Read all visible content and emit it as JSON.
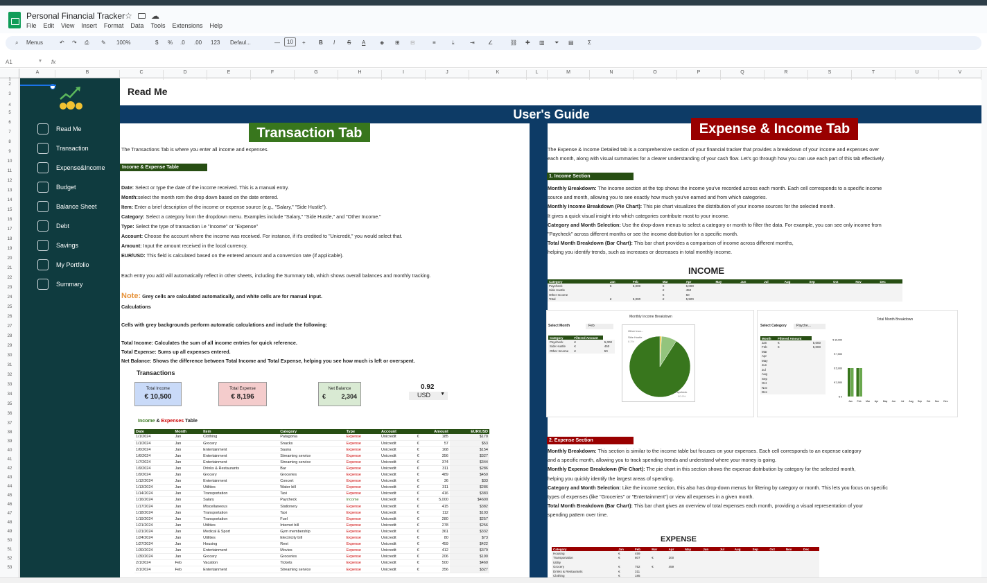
{
  "app": {
    "title": "Personal Financial Tracker",
    "menus": [
      "File",
      "Edit",
      "View",
      "Insert",
      "Format",
      "Data",
      "Tools",
      "Extensions",
      "Help"
    ],
    "toolbar": {
      "search_label": "Menus",
      "zoom": "100%",
      "currency": "$",
      "percent": "%",
      "dec_less": ".0",
      "dec_more": ".00",
      "number_format": "123",
      "font": "Defaul...",
      "font_size": "10",
      "minus": "—",
      "plus": "+",
      "bold": "B",
      "italic": "I",
      "strike": "S",
      "text_color": "A",
      "sigma": "Σ"
    },
    "name_box": "A1",
    "fx": "fx",
    "columns": [
      "A",
      "B",
      "C",
      "D",
      "E",
      "F",
      "G",
      "H",
      "I",
      "J",
      "K",
      "L",
      "M",
      "N",
      "O",
      "P",
      "Q",
      "R",
      "S",
      "T",
      "U",
      "V"
    ],
    "rows": [
      "1",
      "2",
      "3",
      "4",
      "5",
      "6",
      "7",
      "8",
      "9",
      "10",
      "11",
      "12",
      "13",
      "14",
      "15",
      "16",
      "17",
      "18",
      "19",
      "20",
      "21",
      "22",
      "23",
      "24",
      "25",
      "26",
      "27",
      "28",
      "29",
      "30",
      "31",
      "32",
      "33",
      "34",
      "35",
      "36",
      "37",
      "38",
      "39",
      "40",
      "41",
      "42",
      "43",
      "44",
      "45",
      "46",
      "47",
      "48",
      "49",
      "50",
      "51",
      "52",
      "53"
    ]
  },
  "sidebar": {
    "items": [
      {
        "label": "Read Me",
        "icon": "book-reader-icon"
      },
      {
        "label": "Transaction",
        "icon": "receipt-icon"
      },
      {
        "label": "Expense&Income",
        "icon": "coin-dollar-icon"
      },
      {
        "label": "Budget",
        "icon": "wallet-icon"
      },
      {
        "label": "Balance Sheet",
        "icon": "ledger-icon"
      },
      {
        "label": "Debt",
        "icon": "debt-card-icon"
      },
      {
        "label": "Savings",
        "icon": "piggy-bank-icon"
      },
      {
        "label": "My Portfolio",
        "icon": "portfolio-chart-icon"
      },
      {
        "label": "Summary",
        "icon": "summary-icon"
      }
    ]
  },
  "readme": {
    "title": "Read Me",
    "guide_title": "User's Guide",
    "transaction_tab": {
      "title": "Transaction Tab",
      "intro": "The Transactions Tab is where you enter all income and expenses.",
      "section_label": "Income & Expense Table",
      "fields": [
        {
          "k": "Date:",
          "v": " Select or type the date of the income received. This is a manual entry."
        },
        {
          "k": "Month:",
          "v": "select the month rom the drop down based on the date entered."
        },
        {
          "k": "Item:",
          "v": " Enter a brief description of the income or expense source (e.g., \"Salary,\" \"Side Hustle\")."
        },
        {
          "k": "Category:",
          "v": " Select a category from the dropdown menu. Examples include \"Salary,\" \"Side Hustle,\" and \"Other Income.\""
        },
        {
          "k": "Type:",
          "v": " Select the type of transaction i.e \"Income\" or \"Expense\""
        },
        {
          "k": "Account:",
          "v": " Choose the account where the income was received. For instance, if it's credited to \"Unicredit,\" you would select that."
        },
        {
          "k": "Amount:",
          "v": " Input the amount received in the local currency."
        },
        {
          "k": "EUR/USD:",
          "v": " This field is calculated based on the entered amount and a conversion rate (if applicable)."
        }
      ],
      "auto_reflect": "Each entry you add will automatically reflect in other sheets, including the Summary tab, which shows overall balances and monthly tracking.",
      "note_label": "Note:",
      "note_text": " Grey cells are calculated automatically, and white cells are for manual input.",
      "calc_heading": "Calculations",
      "calc_intro": "Cells with grey backgrounds perform automatic calculations and include the following:",
      "calc_items": [
        "Total Income: Calculates the sum of all income entries for quick reference.",
        "Total Expense: Sums up all expenses entered.",
        "Net Balance: Shows the difference between Total Income and Total Expense, helping you see how much is left or overspent."
      ],
      "transactions_heading": "Transactions",
      "kpis": {
        "income_label": "Total Income",
        "income_value": "€ 10,500",
        "expense_label": "Total Expense",
        "expense_value": "€ 8,196",
        "net_label": "Net Balance",
        "net_symbol": "€",
        "net_value": "2,304",
        "rate": "0.92",
        "currency": "USD"
      },
      "table_title_a": "Income",
      "table_title_amp": " & ",
      "table_title_b": "Expenses",
      "table_title_c": " Table",
      "table_headers": [
        "Date",
        "Month",
        "Item",
        "Category",
        "Type",
        "Account",
        "Amount",
        "EUR/USD"
      ],
      "table_rows": [
        [
          "1/1/2024",
          "Jan",
          "Clothing",
          "Patagonia",
          "Expense",
          "Unicredit",
          "€",
          "185",
          "$170"
        ],
        [
          "1/1/2024",
          "Jan",
          "Grocery",
          "Snacks",
          "Expense",
          "Unicredit",
          "€",
          "57",
          "$53"
        ],
        [
          "1/6/2024",
          "Jan",
          "Entertainment",
          "Sauna",
          "Expense",
          "Unicredit",
          "€",
          "168",
          "$154"
        ],
        [
          "1/6/2024",
          "Jan",
          "Entertainment",
          "Streaming service",
          "Expense",
          "Unicredit",
          "€",
          "356",
          "$327"
        ],
        [
          "1/7/2024",
          "Jan",
          "Entertainment",
          "Streaming service",
          "Expense",
          "Unicredit",
          "€",
          "374",
          "$344"
        ],
        [
          "1/9/2024",
          "Jan",
          "Drinks & Restaurants",
          "Bar",
          "Expense",
          "Unicredit",
          "€",
          "311",
          "$286"
        ],
        [
          "1/9/2024",
          "Jan",
          "Grocery",
          "Groceries",
          "Expense",
          "Unicredit",
          "€",
          "489",
          "$450"
        ],
        [
          "1/12/2024",
          "Jan",
          "Entertainment",
          "Concert",
          "Expense",
          "Unicredit",
          "€",
          "36",
          "$33"
        ],
        [
          "1/13/2024",
          "Jan",
          "Utilities",
          "Water bill",
          "Expense",
          "Unicredit",
          "€",
          "311",
          "$286"
        ],
        [
          "1/14/2024",
          "Jan",
          "Transportation",
          "Taxi",
          "Expense",
          "Unicredit",
          "€",
          "416",
          "$383"
        ],
        [
          "1/16/2024",
          "Jan",
          "Salary",
          "Paycheck",
          "Income",
          "Unicredit",
          "€",
          "5,000",
          "$4600"
        ],
        [
          "1/17/2024",
          "Jan",
          "Miscellaneous",
          "Stationery",
          "Expense",
          "Unicredit",
          "€",
          "415",
          "$382"
        ],
        [
          "1/18/2024",
          "Jan",
          "Transportation",
          "Taxi",
          "Expense",
          "Unicredit",
          "€",
          "112",
          "$103"
        ],
        [
          "1/19/2024",
          "Jan",
          "Transportation",
          "Fuel",
          "Expense",
          "Unicredit",
          "€",
          "280",
          "$257"
        ],
        [
          "1/21/2024",
          "Jan",
          "Utilities",
          "Internet bill",
          "Expense",
          "Unicredit",
          "€",
          "278",
          "$256"
        ],
        [
          "1/21/2024",
          "Jan",
          "Medical & Sport",
          "Gym membership",
          "Expense",
          "Unicredit",
          "€",
          "361",
          "$332"
        ],
        [
          "1/24/2024",
          "Jan",
          "Utilities",
          "Electricity bill",
          "Expense",
          "Unicredit",
          "€",
          "80",
          "$73"
        ],
        [
          "1/27/2024",
          "Jan",
          "Housing",
          "Rent",
          "Expense",
          "Unicredit",
          "€",
          "459",
          "$422"
        ],
        [
          "1/30/2024",
          "Jan",
          "Entertainment",
          "Movies",
          "Expense",
          "Unicredit",
          "€",
          "412",
          "$379"
        ],
        [
          "1/30/2024",
          "Jan",
          "Grocery",
          "Groceries",
          "Expense",
          "Unicredit",
          "€",
          "206",
          "$190"
        ],
        [
          "2/1/2024",
          "Feb",
          "Vacation",
          "Tickets",
          "Expense",
          "Unicredit",
          "€",
          "500",
          "$460"
        ],
        [
          "2/1/2024",
          "Feb",
          "Entertainment",
          "Streaming service",
          "Expense",
          "Unicredit",
          "€",
          "356",
          "$327"
        ]
      ]
    },
    "expense_income_tab": {
      "title": "Expense & Income Tab",
      "intro_1": "The Expense & Income Detailed tab is a comprehensive section of your financial tracker that provides a breakdown of your income and expenses over",
      "intro_2": "each month, along with visual summaries for a clearer understanding of your cash flow. Let's go through how you can use each part of this tab effectively.",
      "income_section_label": "1. Income Section",
      "income_lines": [
        {
          "k": "Monthly Breakdown:",
          "v": " The Income section at the top shows the income you've recorded across each month. Each cell corresponds to a specific income"
        },
        {
          "k": "",
          "v": "source and month, allowing you to see exactly how much you've earned and from which categories."
        },
        {
          "k": "Monthly Income Breakdown (Pie Chart):",
          "v": " This pie chart visualizes the distribution of your income sources for the selected month."
        },
        {
          "k": "",
          "v": "It gives a quick visual insight into which categories contribute most to your income."
        },
        {
          "k": "Category and Month Selection:",
          "v": " Use the drop-down menus to select a category or month to filter the data. For example, you can see only income from"
        },
        {
          "k": "",
          "v": "\"Paycheck\" across different months or see the income distribution for a specific month."
        },
        {
          "k": "Total Month Breakdown (Bar Chart):",
          "v": " This bar chart provides a comparison of income across different months,"
        },
        {
          "k": "",
          "v": "helping you identify trends, such as increases or decreases in total monthly income."
        }
      ],
      "income_heading": "INCOME",
      "income_table": {
        "headers": [
          "Category",
          "Jan",
          "Feb",
          "Mar",
          "Apr",
          "May",
          "Jun",
          "Jul",
          "Aug",
          "Sep",
          "Oct",
          "Nov",
          "Dec"
        ],
        "rows": [
          [
            "Paycheck",
            "€",
            "5,000",
            "€",
            "5,000"
          ],
          [
            "Side Hustle",
            "",
            "",
            "€",
            "450"
          ],
          [
            "Other Income",
            "",
            "",
            "€",
            "50"
          ],
          [
            "Total",
            "€",
            "5,000",
            "€",
            "5,500"
          ]
        ]
      },
      "pie_title": "Monthly Income Breakdown",
      "pie_legend": [
        "Other Inco...",
        "Side Hustle",
        "Paycheck"
      ],
      "pie_small_label": "8.2%",
      "pie_big_label": "90.9%",
      "select_month_label": "Select Month",
      "select_month_value": "Feb",
      "filter_headers": [
        "Category",
        "Filtered Amount"
      ],
      "filter_rows": [
        [
          "Paycheck",
          "€",
          "5,000"
        ],
        [
          "Side Hustle",
          "€",
          "450"
        ],
        [
          "Other Income",
          "€",
          "50"
        ]
      ],
      "select_category_label": "Select Category",
      "select_category_value": "Payche...",
      "month_headers": [
        "Month",
        "Filtered Amount"
      ],
      "month_rows": [
        [
          "Jan",
          "€",
          "5,000"
        ],
        [
          "Feb",
          "€",
          "5,000"
        ],
        [
          "Mar",
          "",
          ""
        ],
        [
          "Apr",
          "",
          ""
        ],
        [
          "May",
          "",
          ""
        ],
        [
          "Jun",
          "",
          ""
        ],
        [
          "Jul",
          "",
          ""
        ],
        [
          "Aug",
          "",
          ""
        ],
        [
          "Sep",
          "",
          ""
        ],
        [
          "Oct",
          "",
          ""
        ],
        [
          "Nov",
          "",
          ""
        ],
        [
          "Dec",
          "",
          ""
        ]
      ],
      "bar_title": "Total Month Breakdown",
      "expense_section_label": "2. Expense Section",
      "expense_lines": [
        {
          "k": "Monthly Breakdown:",
          "v": " This section is similar to the income table but focuses on your expenses. Each cell corresponds to an expense category"
        },
        {
          "k": "",
          "v": "and a specific month, allowing you to track spending trends and understand where your money is going."
        },
        {
          "k": "Monthly Expense Breakdown (Pie Chart):",
          "v": " The pie chart in this section shows the expense distribution by category for the selected month,"
        },
        {
          "k": "",
          "v": "helping you quickly identify the largest areas of spending."
        },
        {
          "k": "Category and Month Selection:",
          "v": " Like the income section, this also has drop-down menus for filtering by category or month. This lets you focus on specific"
        },
        {
          "k": "",
          "v": "types of expenses (like \"Groceries\" or \"Entertainment\") or view all expenses in a given month."
        },
        {
          "k": "Total Month Breakdown (Bar Chart):",
          "v": " This bar chart gives an overview of total expenses each month, providing a visual representation of your"
        },
        {
          "k": "",
          "v": "spending pattern over time."
        }
      ],
      "expense_heading": "EXPENSE",
      "expense_table": {
        "headers": [
          "Category",
          "Jan",
          "Feb",
          "Mar",
          "Apr",
          "May",
          "Jun",
          "Jul",
          "Aug",
          "Sep",
          "Oct",
          "Nov",
          "Dec"
        ],
        "rows": [
          [
            "Housing",
            "€",
            "459",
            "",
            ""
          ],
          [
            "Transportation",
            "€",
            "807",
            "€",
            "200"
          ],
          [
            "Utility",
            "",
            "",
            "",
            ""
          ],
          [
            "Grocery",
            "€",
            "752",
            "€",
            "459"
          ],
          [
            "Drinks & Restaurants",
            "€",
            "311",
            "",
            ""
          ],
          [
            "Clothing",
            "€",
            "185",
            "",
            ""
          ]
        ]
      }
    }
  },
  "colors": {
    "sidebar": "#0f3b3f",
    "navy": "#0d3b66",
    "green": "#38761d",
    "dark_green": "#274e13",
    "red": "#990000"
  }
}
